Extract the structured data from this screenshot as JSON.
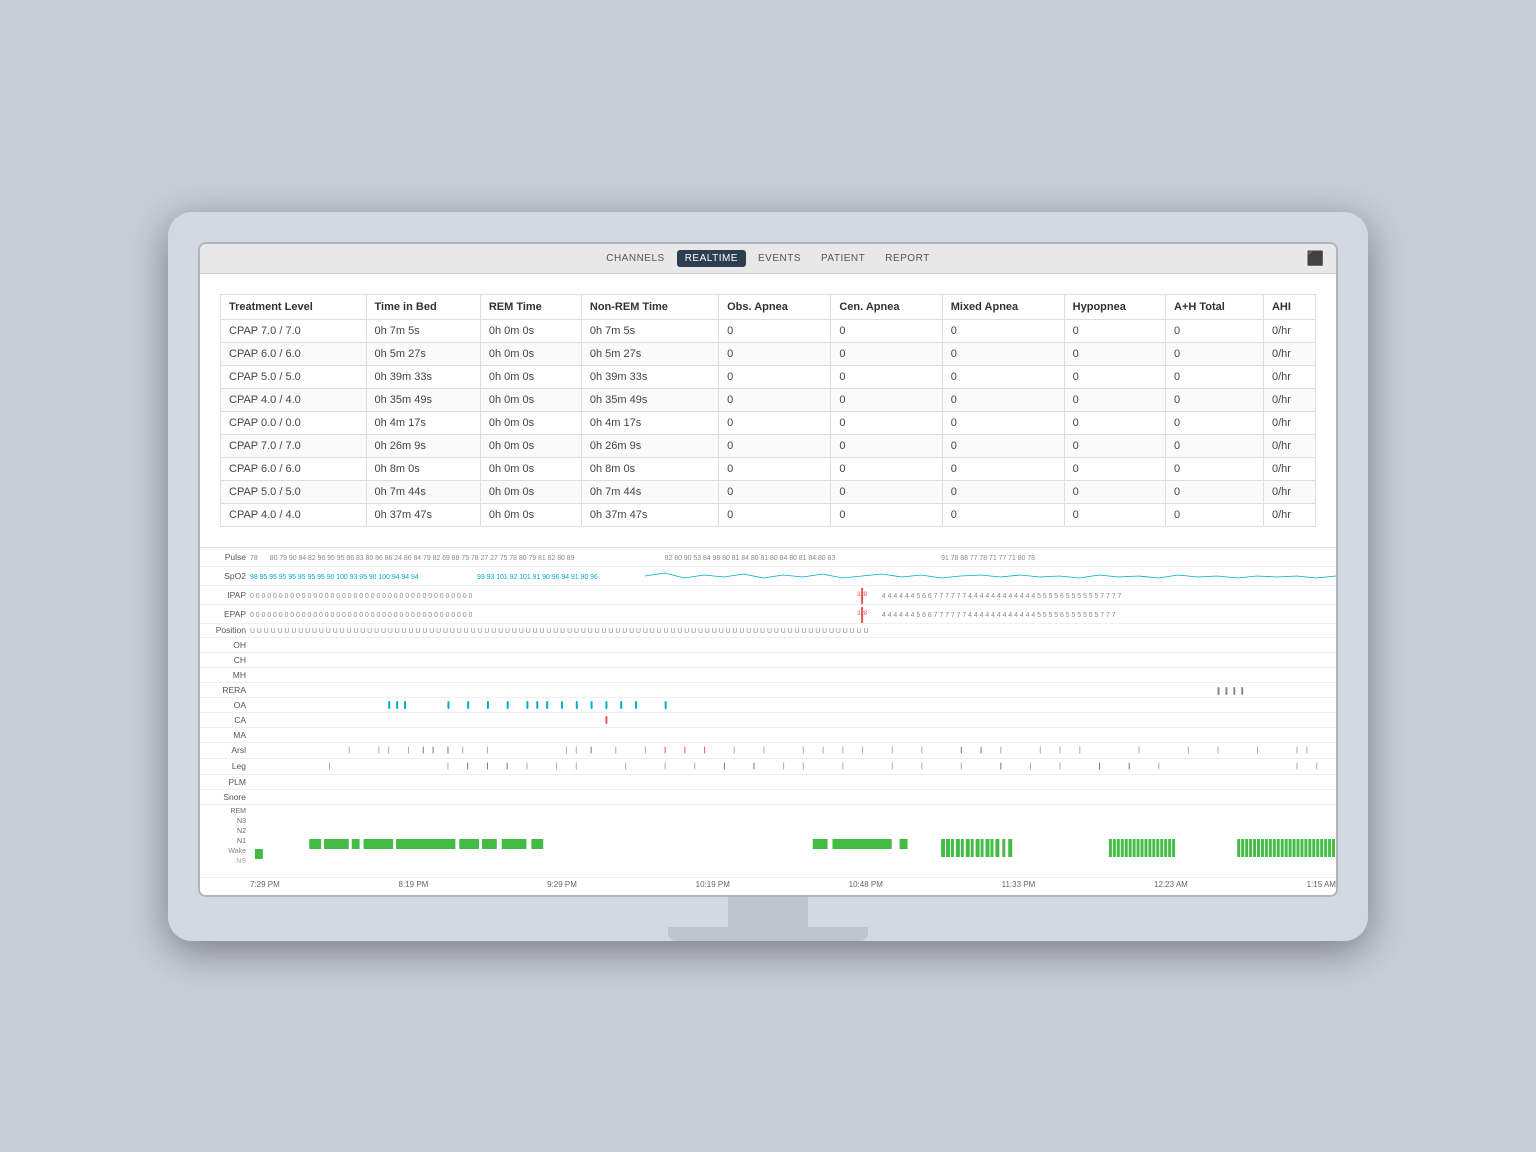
{
  "nav": {
    "tabs": [
      "CHANNELS",
      "REALTIME",
      "EVENTS",
      "PATIENT",
      "REPORT"
    ],
    "active": "REALTIME"
  },
  "table": {
    "headers": [
      "Treatment Level",
      "Time in Bed",
      "REM Time",
      "Non-REM Time",
      "Obs. Apnea",
      "Cen. Apnea",
      "Mixed Apnea",
      "Hypopnea",
      "A+H Total",
      "AHI"
    ],
    "rows": [
      [
        "CPAP 7.0 / 7.0",
        "0h 7m 5s",
        "0h 0m 0s",
        "0h 7m 5s",
        "0",
        "0",
        "0",
        "0",
        "0",
        "0/hr"
      ],
      [
        "CPAP 6.0 / 6.0",
        "0h 5m 27s",
        "0h 0m 0s",
        "0h 5m 27s",
        "0",
        "0",
        "0",
        "0",
        "0",
        "0/hr"
      ],
      [
        "CPAP 5.0 / 5.0",
        "0h 39m 33s",
        "0h 0m 0s",
        "0h 39m 33s",
        "0",
        "0",
        "0",
        "0",
        "0",
        "0/hr"
      ],
      [
        "CPAP 4.0 / 4.0",
        "0h 35m 49s",
        "0h 0m 0s",
        "0h 35m 49s",
        "0",
        "0",
        "0",
        "0",
        "0",
        "0/hr"
      ],
      [
        "CPAP 0.0 / 0.0",
        "0h 4m 17s",
        "0h 0m 0s",
        "0h 4m 17s",
        "0",
        "0",
        "0",
        "0",
        "0",
        "0/hr"
      ],
      [
        "CPAP 7.0 / 7.0",
        "0h 26m 9s",
        "0h 0m 0s",
        "0h 26m 9s",
        "0",
        "0",
        "0",
        "0",
        "0",
        "0/hr"
      ],
      [
        "CPAP 6.0 / 6.0",
        "0h 8m 0s",
        "0h 0m 0s",
        "0h 8m 0s",
        "0",
        "0",
        "0",
        "0",
        "0",
        "0/hr"
      ],
      [
        "CPAP 5.0 / 5.0",
        "0h 7m 44s",
        "0h 0m 0s",
        "0h 7m 44s",
        "0",
        "0",
        "0",
        "0",
        "0",
        "0/hr"
      ],
      [
        "CPAP 4.0 / 4.0",
        "0h 37m 47s",
        "0h 0m 0s",
        "0h 37m 47s",
        "0",
        "0",
        "0",
        "0",
        "0",
        "0/hr"
      ]
    ]
  },
  "chart_labels": {
    "pulse": "Pulse",
    "spo2": "SpO2",
    "ipap": "IPAP",
    "epap": "EPAP",
    "position": "Position",
    "oh": "OH",
    "ch": "CH",
    "mh": "MH",
    "rera": "RERA",
    "oa": "OA",
    "ca": "CA",
    "ma": "MA",
    "arsl": "Arsl",
    "leg": "Leg",
    "plm": "PLM",
    "snore": "Snore",
    "rem": "REM",
    "n1": "N1",
    "n2": "N2",
    "n3": "N3",
    "wake": "Wake",
    "ns": "NS"
  },
  "timeline": {
    "labels": [
      "7:29 PM",
      "8:19 PM",
      "9:29 PM",
      "10:19 PM",
      "10:48 PM",
      "11:33 PM",
      "12:23 AM",
      "1:15 AM"
    ]
  },
  "colors": {
    "accent_teal": "#00aacc",
    "accent_red": "#e05555",
    "sleep_green": "#44bb44",
    "nav_active_bg": "#2c3e50",
    "table_border": "#dddddd"
  }
}
